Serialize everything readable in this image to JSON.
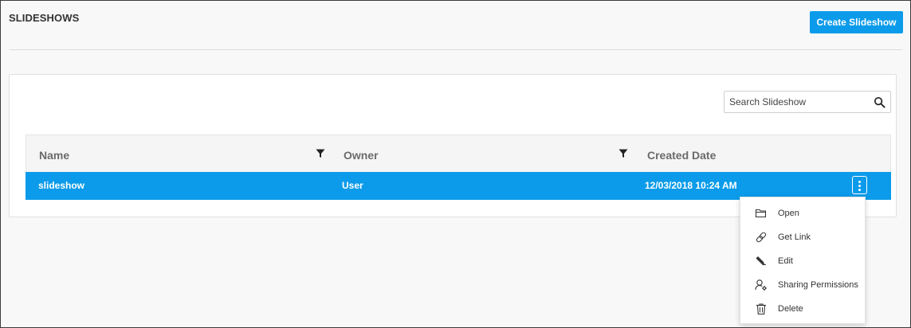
{
  "page": {
    "title": "SLIDESHOWS",
    "create_button_label": "Create Slideshow"
  },
  "search": {
    "placeholder": "Search Slideshow",
    "icon": "search-icon"
  },
  "table": {
    "columns": [
      {
        "label": "Name",
        "filterable": true
      },
      {
        "label": "Owner",
        "filterable": true
      },
      {
        "label": "Created Date",
        "filterable": false
      }
    ],
    "rows": [
      {
        "name": "slideshow",
        "owner": "User",
        "created": "12/03/2018 10:24 AM",
        "selected": true
      }
    ]
  },
  "context_menu": {
    "items": [
      {
        "label": "Open",
        "icon": "folder-open-icon"
      },
      {
        "label": "Get Link",
        "icon": "link-icon"
      },
      {
        "label": "Edit",
        "icon": "pencil-icon"
      },
      {
        "label": "Sharing Permissions",
        "icon": "user-settings-icon"
      },
      {
        "label": "Delete",
        "icon": "trash-icon"
      }
    ]
  },
  "colors": {
    "accent": "#0b9bea",
    "background": "#f8f8f8",
    "header_bg": "#f5f5f5"
  }
}
